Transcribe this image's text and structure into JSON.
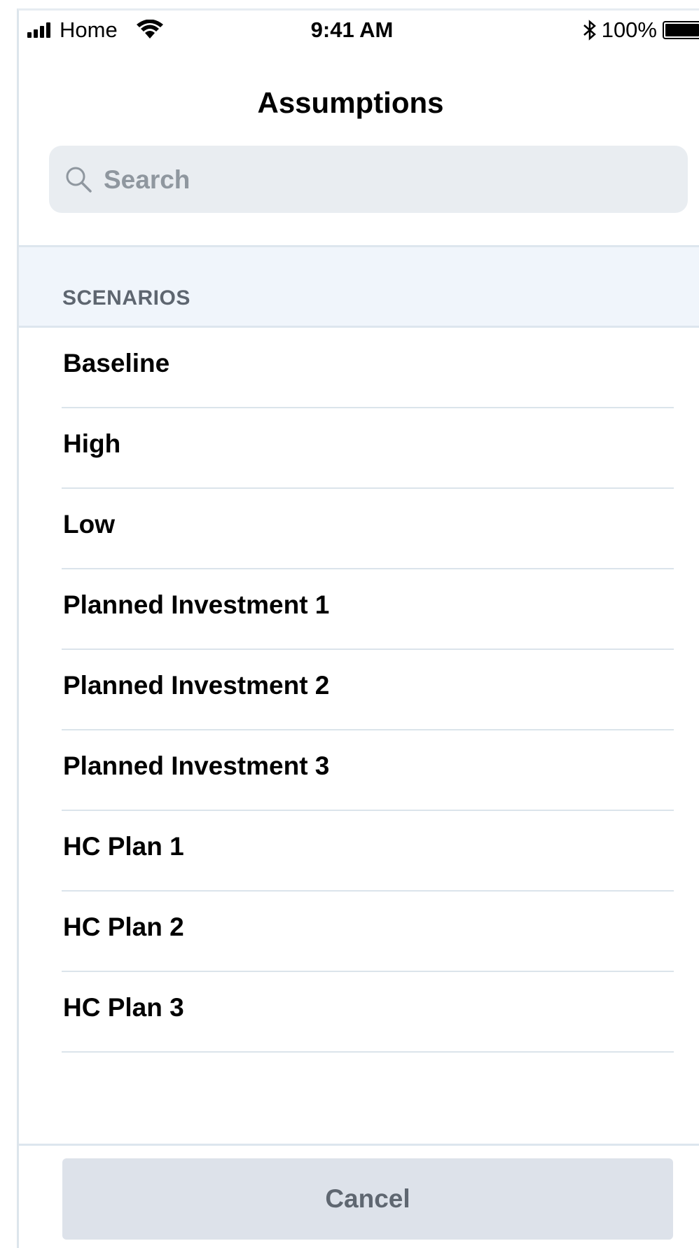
{
  "status_bar": {
    "carrier": "Home",
    "time": "9:41 AM",
    "battery": "100%",
    "battery_level": 1.0
  },
  "header": {
    "title": "Assumptions"
  },
  "search": {
    "placeholder": "Search",
    "value": ""
  },
  "section": {
    "label": "SCENARIOS"
  },
  "scenarios": [
    {
      "label": "Baseline"
    },
    {
      "label": "High"
    },
    {
      "label": "Low"
    },
    {
      "label": "Planned Investment 1"
    },
    {
      "label": "Planned Investment 2"
    },
    {
      "label": "Planned Investment 3"
    },
    {
      "label": "HC Plan 1"
    },
    {
      "label": "HC Plan 2"
    },
    {
      "label": "HC Plan 3"
    }
  ],
  "footer": {
    "cancel_label": "Cancel"
  },
  "colors": {
    "search_bg": "#e9edf1",
    "section_bg": "#f0f5fb",
    "divider": "#dbe4eb",
    "cancel_bg": "#dde2ea",
    "cancel_text": "#5f6771"
  }
}
